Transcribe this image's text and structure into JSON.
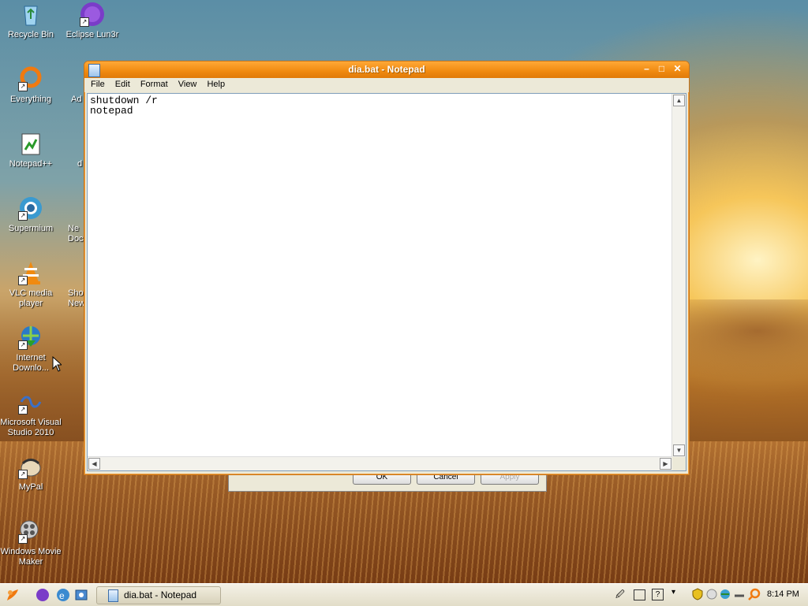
{
  "desktop": {
    "icons": [
      {
        "label": "Recycle Bin",
        "icon": "recycle-bin-icon"
      },
      {
        "label": "Eclipse Lun3r",
        "icon": "eclipse-icon"
      },
      {
        "label": "Everything",
        "icon": "everything-icon"
      },
      {
        "label": "Ad",
        "icon": "adobe-icon"
      },
      {
        "label": "Notepad++",
        "icon": "notepadpp-icon"
      },
      {
        "label": "d",
        "icon": "file-icon"
      },
      {
        "label": "Supermium",
        "icon": "supermium-icon"
      },
      {
        "label": "Ne\nDoc",
        "icon": "document-icon"
      },
      {
        "label": "VLC media\nplayer",
        "icon": "vlc-icon"
      },
      {
        "label": "Sho\nNew",
        "icon": "shortcut-icon"
      },
      {
        "label": "Internet\nDownlo...",
        "icon": "idm-icon"
      },
      {
        "label": "Microsoft Visual\nStudio 2010",
        "icon": "visual-studio-icon"
      },
      {
        "label": "MyPal",
        "icon": "mypal-icon"
      },
      {
        "label": "Windows Movie\nMaker",
        "icon": "movie-maker-icon"
      }
    ]
  },
  "back_dialog": {
    "ok": "OK",
    "cancel": "Cancel",
    "apply": "Apply"
  },
  "notepad": {
    "title": "dia.bat - Notepad",
    "menu": [
      "File",
      "Edit",
      "Format",
      "View",
      "Help"
    ],
    "content": "shutdown /r\nnotepad"
  },
  "taskbar": {
    "task_label": "dia.bat - Notepad",
    "clock": "8:14 PM"
  },
  "colors": {
    "title_bar": "#f08a10",
    "taskbar": "#ece9d8"
  }
}
